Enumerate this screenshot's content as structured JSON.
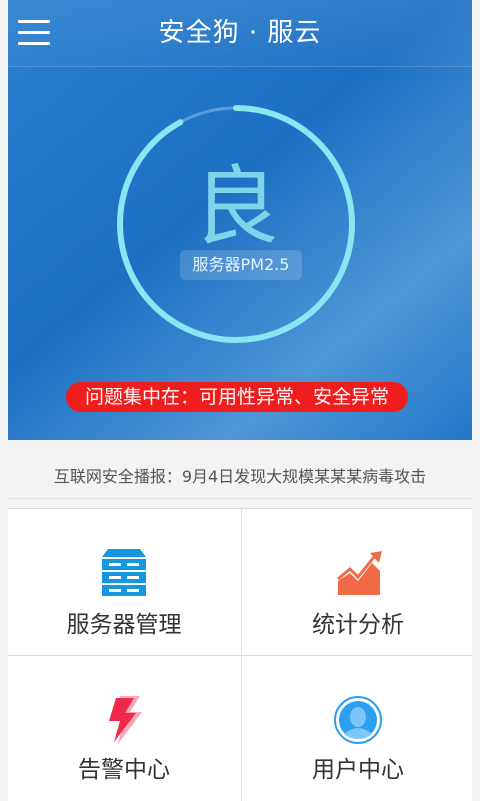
{
  "header": {
    "title": "安全狗 · 服云",
    "menu_icon": "menu-icon"
  },
  "status": {
    "grade": "良",
    "pm_label": "服务器PM2.5",
    "score_fraction": 0.92,
    "problem_text": "问题集中在：可用性异常、安全异常"
  },
  "news": {
    "text": "互联网安全播报：9月4日发现大规模某某某病毒攻击"
  },
  "grid": {
    "items": [
      {
        "label": "服务器管理",
        "icon": "server-icon"
      },
      {
        "label": "统计分析",
        "icon": "chart-up-icon"
      },
      {
        "label": "告警中心",
        "icon": "lightning-icon"
      },
      {
        "label": "用户中心",
        "icon": "user-avatar-icon"
      }
    ]
  },
  "colors": {
    "hero_blue": "#1f73c6",
    "ring_cyan": "#8ae6f2",
    "alert_red": "#ef1d1d",
    "server_blue": "#1598e0",
    "chart_orange": "#f06a45",
    "bolt_red": "#f0294a",
    "avatar_blue": "#2d9ff0"
  }
}
